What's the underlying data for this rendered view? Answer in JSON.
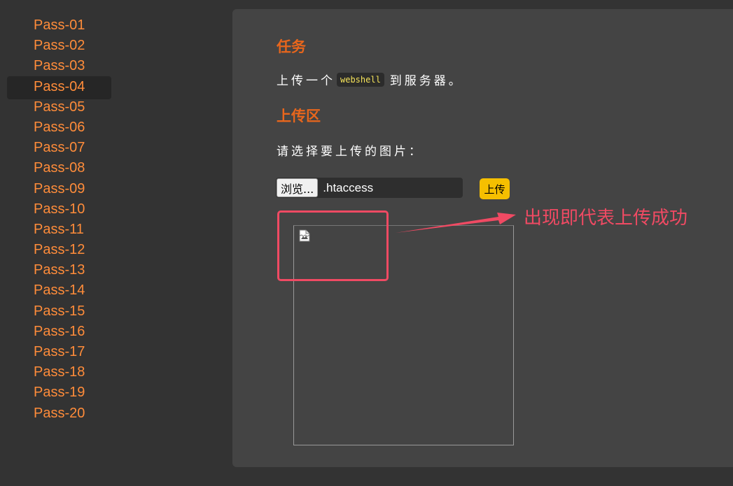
{
  "sidebar": {
    "items": [
      {
        "label": "Pass-01"
      },
      {
        "label": "Pass-02"
      },
      {
        "label": "Pass-03"
      },
      {
        "label": "Pass-04"
      },
      {
        "label": "Pass-05"
      },
      {
        "label": "Pass-06"
      },
      {
        "label": "Pass-07"
      },
      {
        "label": "Pass-08"
      },
      {
        "label": "Pass-09"
      },
      {
        "label": "Pass-10"
      },
      {
        "label": "Pass-11"
      },
      {
        "label": "Pass-12"
      },
      {
        "label": "Pass-13"
      },
      {
        "label": "Pass-14"
      },
      {
        "label": "Pass-15"
      },
      {
        "label": "Pass-16"
      },
      {
        "label": "Pass-17"
      },
      {
        "label": "Pass-18"
      },
      {
        "label": "Pass-19"
      },
      {
        "label": "Pass-20"
      }
    ],
    "active_index": 3
  },
  "main": {
    "task_heading": "任务",
    "task_text_before": "上传一个",
    "task_code": "webshell",
    "task_text_after": "到服务器。",
    "upload_heading": "上传区",
    "prompt": "请选择要上传的图片：",
    "browse_label": "浏览...",
    "file_name": ".htaccess",
    "upload_label": "上传",
    "preview_icon": "broken-image-icon"
  },
  "annotation": {
    "text": "出现即代表上传成功",
    "color": "#f04a63"
  },
  "colors": {
    "background": "#333333",
    "panel": "#444444",
    "link": "#ff8c3a",
    "heading": "#e8661c",
    "button_accent": "#f5bf00"
  }
}
